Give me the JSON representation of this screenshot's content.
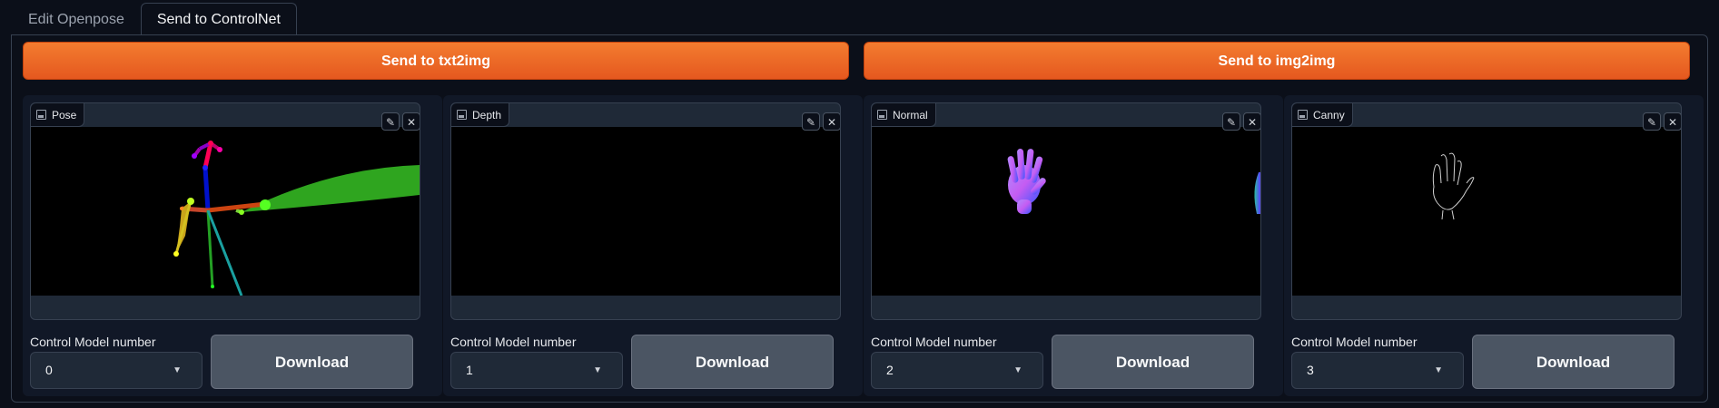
{
  "tabs": [
    {
      "label": "Edit Openpose",
      "active": false
    },
    {
      "label": "Send to ControlNet",
      "active": true
    }
  ],
  "send_buttons": {
    "txt2img": "Send to txt2img",
    "img2img": "Send to img2img"
  },
  "accent_color": "#ea6a26",
  "units": [
    {
      "image_label": "Pose",
      "control_label": "Control Model number",
      "model_number": "0",
      "download_label": "Download"
    },
    {
      "image_label": "Depth",
      "control_label": "Control Model number",
      "model_number": "1",
      "download_label": "Download"
    },
    {
      "image_label": "Normal",
      "control_label": "Control Model number",
      "model_number": "2",
      "download_label": "Download"
    },
    {
      "image_label": "Canny",
      "control_label": "Control Model number",
      "model_number": "3",
      "download_label": "Download"
    }
  ],
  "icons": {
    "image": "image-icon",
    "edit": "pencil-icon",
    "clear": "close-icon",
    "dropdown": "chevron-down-icon"
  }
}
